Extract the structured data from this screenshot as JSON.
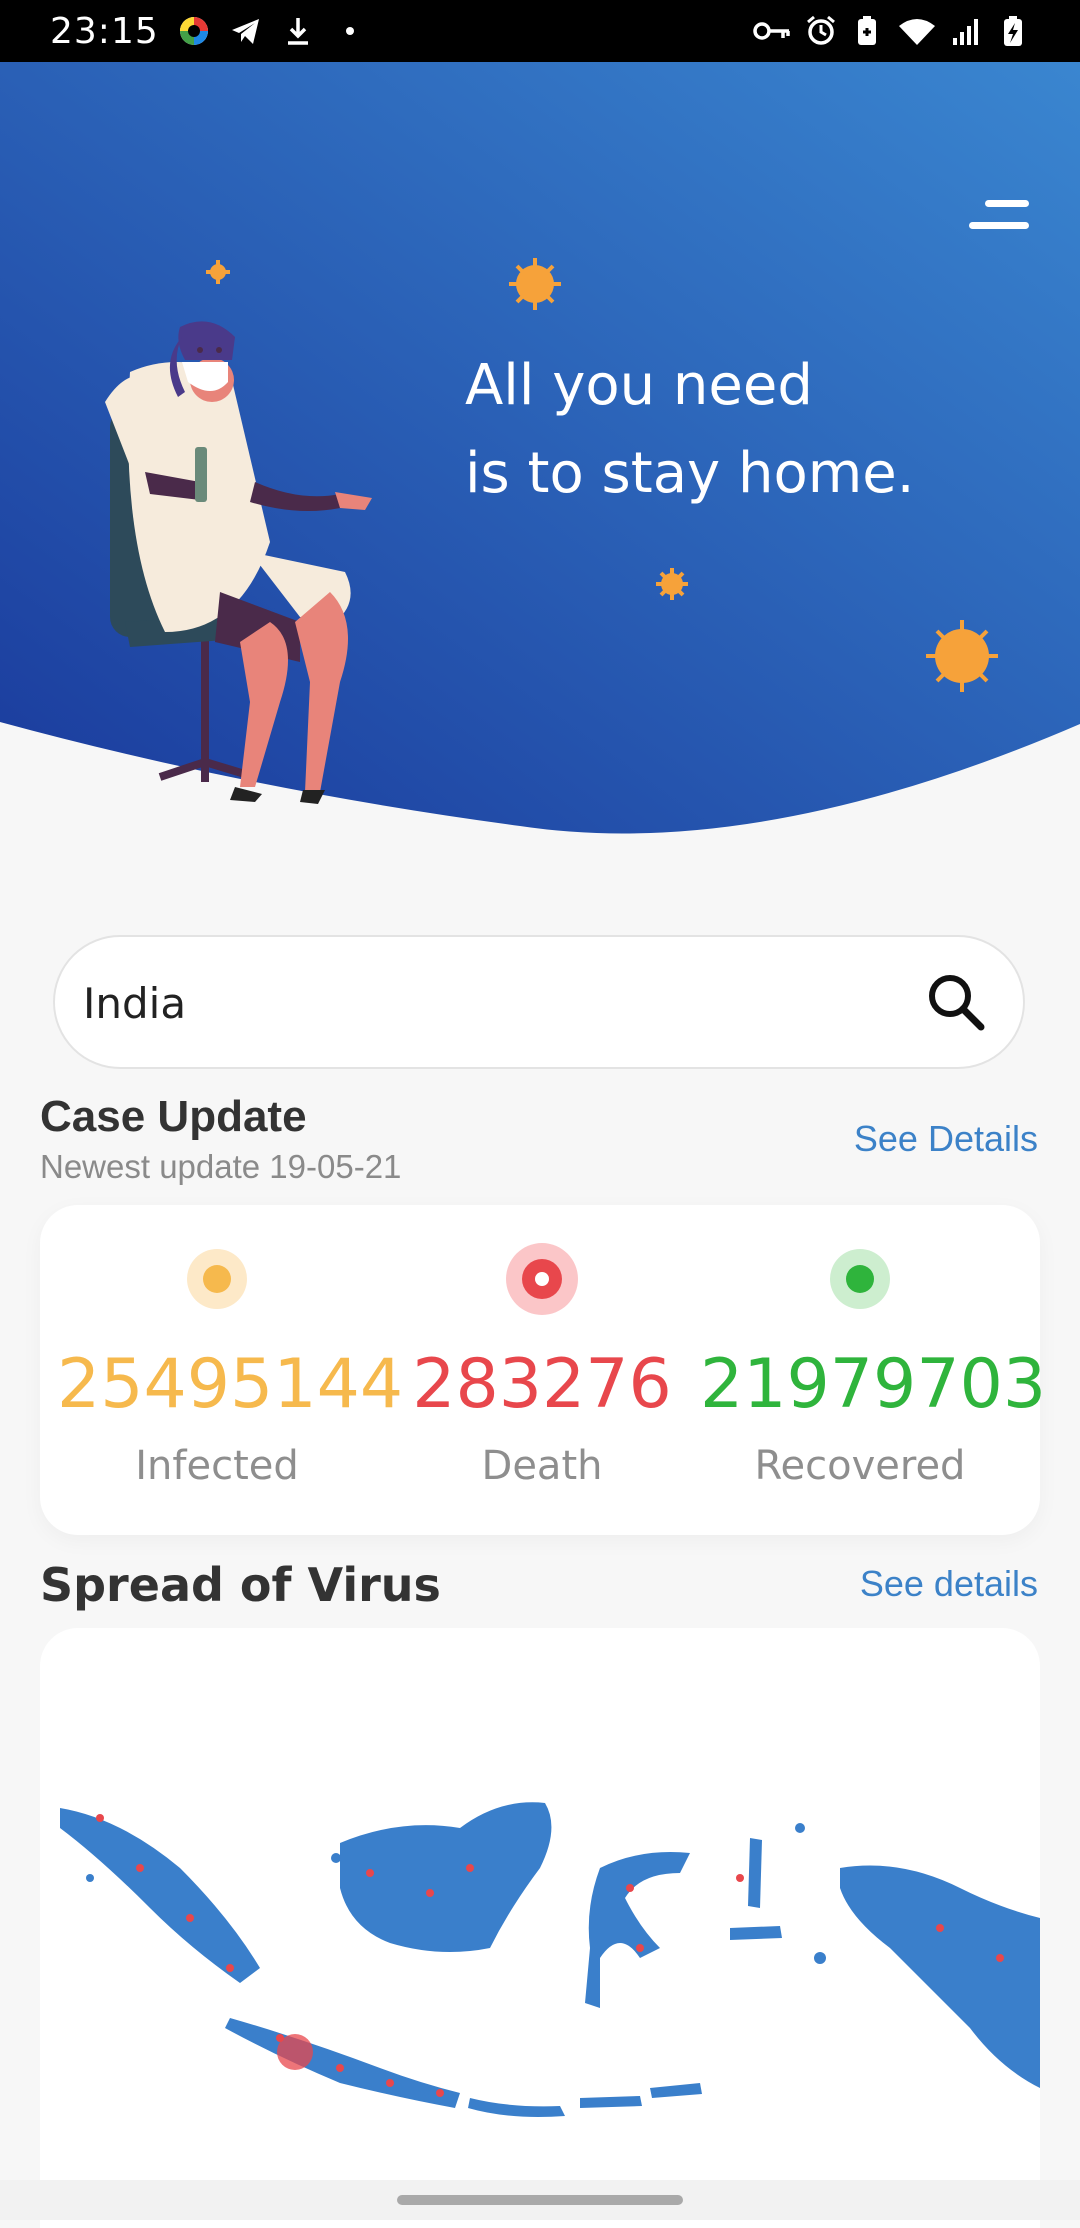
{
  "status_bar": {
    "time": "23:15",
    "left_icons": [
      "app-icon",
      "telegram-icon",
      "download-icon",
      "dot-icon"
    ],
    "right_icons": [
      "vpn-key-icon",
      "alarm-icon",
      "battery-saver-icon",
      "wifi-icon",
      "signal-icon",
      "battery-charging-icon"
    ]
  },
  "hero": {
    "line1": "All you need",
    "line2": "is to stay home.",
    "colors": {
      "gradient_start": "#1a3a9c",
      "gradient_end": "#3a86d0",
      "virus": "#f6a23a"
    }
  },
  "search": {
    "value": "India",
    "placeholder": "India"
  },
  "case_update": {
    "title": "Case Update",
    "subtitle": "Newest update 19-05-21",
    "link": "See Details",
    "stats": [
      {
        "value": "25495144",
        "label": "Infected",
        "color": "#f6b94d"
      },
      {
        "value": "283276",
        "label": "Death",
        "color": "#e8474c"
      },
      {
        "value": "21979703",
        "label": "Recovered",
        "color": "#2fb43c"
      }
    ]
  },
  "spread": {
    "title": "Spread of Virus",
    "link": "See details",
    "map_color": "#3a7fcb",
    "marker_color": "#e8474c"
  }
}
